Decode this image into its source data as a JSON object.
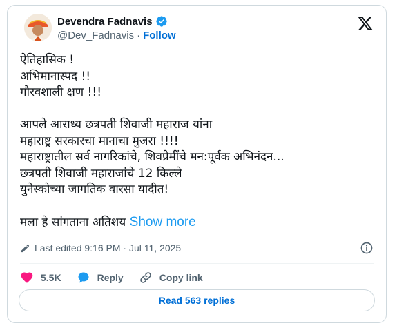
{
  "author": {
    "name": "Devendra Fadnavis",
    "handle": "@Dev_Fadnavis",
    "separator": "·",
    "follow_label": "Follow"
  },
  "post": {
    "lines": [
      "ऐतिहासिक !",
      "अभिमानास्पद !!",
      "गौरवशाली क्षण !!!",
      "",
      "आपले आराध्य छत्रपती शिवाजी महाराज यांना",
      "महाराष्ट्र सरकारचा मानाचा मुजरा !!!!",
      "महाराष्ट्रातील सर्व नागरिकांचे, शिवप्रेमींचे मन:पूर्वक अभिनंदन...",
      "छत्रपती शिवाजी महाराजांचे 12 किल्ले",
      "युनेस्कोच्या जागतिक वारसा यादीत!",
      ""
    ],
    "last_line": "मला हे सांगताना अतिशय",
    "show_more_label": "Show more"
  },
  "meta": {
    "edited_text": "Last edited 9:16 PM · Jul 11, 2025"
  },
  "actions": {
    "like_count": "5.5K",
    "reply_label": "Reply",
    "copy_link_label": "Copy link"
  },
  "read_replies_label": "Read 563 replies",
  "colors": {
    "link_blue": "#006fd6",
    "like_red": "#f91880",
    "reply_blue": "#1d9bf0",
    "text_gray": "#536471"
  }
}
